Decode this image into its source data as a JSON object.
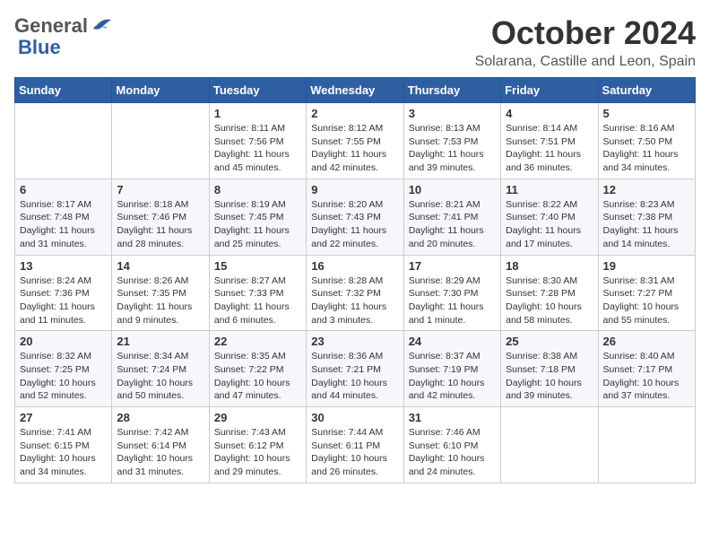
{
  "header": {
    "logo_general": "General",
    "logo_blue": "Blue",
    "month": "October 2024",
    "location": "Solarana, Castille and Leon, Spain"
  },
  "weekdays": [
    "Sunday",
    "Monday",
    "Tuesday",
    "Wednesday",
    "Thursday",
    "Friday",
    "Saturday"
  ],
  "weeks": [
    [
      {
        "day": "",
        "sunrise": "",
        "sunset": "",
        "daylight": ""
      },
      {
        "day": "",
        "sunrise": "",
        "sunset": "",
        "daylight": ""
      },
      {
        "day": "1",
        "sunrise": "Sunrise: 8:11 AM",
        "sunset": "Sunset: 7:56 PM",
        "daylight": "Daylight: 11 hours and 45 minutes."
      },
      {
        "day": "2",
        "sunrise": "Sunrise: 8:12 AM",
        "sunset": "Sunset: 7:55 PM",
        "daylight": "Daylight: 11 hours and 42 minutes."
      },
      {
        "day": "3",
        "sunrise": "Sunrise: 8:13 AM",
        "sunset": "Sunset: 7:53 PM",
        "daylight": "Daylight: 11 hours and 39 minutes."
      },
      {
        "day": "4",
        "sunrise": "Sunrise: 8:14 AM",
        "sunset": "Sunset: 7:51 PM",
        "daylight": "Daylight: 11 hours and 36 minutes."
      },
      {
        "day": "5",
        "sunrise": "Sunrise: 8:16 AM",
        "sunset": "Sunset: 7:50 PM",
        "daylight": "Daylight: 11 hours and 34 minutes."
      }
    ],
    [
      {
        "day": "6",
        "sunrise": "Sunrise: 8:17 AM",
        "sunset": "Sunset: 7:48 PM",
        "daylight": "Daylight: 11 hours and 31 minutes."
      },
      {
        "day": "7",
        "sunrise": "Sunrise: 8:18 AM",
        "sunset": "Sunset: 7:46 PM",
        "daylight": "Daylight: 11 hours and 28 minutes."
      },
      {
        "day": "8",
        "sunrise": "Sunrise: 8:19 AM",
        "sunset": "Sunset: 7:45 PM",
        "daylight": "Daylight: 11 hours and 25 minutes."
      },
      {
        "day": "9",
        "sunrise": "Sunrise: 8:20 AM",
        "sunset": "Sunset: 7:43 PM",
        "daylight": "Daylight: 11 hours and 22 minutes."
      },
      {
        "day": "10",
        "sunrise": "Sunrise: 8:21 AM",
        "sunset": "Sunset: 7:41 PM",
        "daylight": "Daylight: 11 hours and 20 minutes."
      },
      {
        "day": "11",
        "sunrise": "Sunrise: 8:22 AM",
        "sunset": "Sunset: 7:40 PM",
        "daylight": "Daylight: 11 hours and 17 minutes."
      },
      {
        "day": "12",
        "sunrise": "Sunrise: 8:23 AM",
        "sunset": "Sunset: 7:38 PM",
        "daylight": "Daylight: 11 hours and 14 minutes."
      }
    ],
    [
      {
        "day": "13",
        "sunrise": "Sunrise: 8:24 AM",
        "sunset": "Sunset: 7:36 PM",
        "daylight": "Daylight: 11 hours and 11 minutes."
      },
      {
        "day": "14",
        "sunrise": "Sunrise: 8:26 AM",
        "sunset": "Sunset: 7:35 PM",
        "daylight": "Daylight: 11 hours and 9 minutes."
      },
      {
        "day": "15",
        "sunrise": "Sunrise: 8:27 AM",
        "sunset": "Sunset: 7:33 PM",
        "daylight": "Daylight: 11 hours and 6 minutes."
      },
      {
        "day": "16",
        "sunrise": "Sunrise: 8:28 AM",
        "sunset": "Sunset: 7:32 PM",
        "daylight": "Daylight: 11 hours and 3 minutes."
      },
      {
        "day": "17",
        "sunrise": "Sunrise: 8:29 AM",
        "sunset": "Sunset: 7:30 PM",
        "daylight": "Daylight: 11 hours and 1 minute."
      },
      {
        "day": "18",
        "sunrise": "Sunrise: 8:30 AM",
        "sunset": "Sunset: 7:28 PM",
        "daylight": "Daylight: 10 hours and 58 minutes."
      },
      {
        "day": "19",
        "sunrise": "Sunrise: 8:31 AM",
        "sunset": "Sunset: 7:27 PM",
        "daylight": "Daylight: 10 hours and 55 minutes."
      }
    ],
    [
      {
        "day": "20",
        "sunrise": "Sunrise: 8:32 AM",
        "sunset": "Sunset: 7:25 PM",
        "daylight": "Daylight: 10 hours and 52 minutes."
      },
      {
        "day": "21",
        "sunrise": "Sunrise: 8:34 AM",
        "sunset": "Sunset: 7:24 PM",
        "daylight": "Daylight: 10 hours and 50 minutes."
      },
      {
        "day": "22",
        "sunrise": "Sunrise: 8:35 AM",
        "sunset": "Sunset: 7:22 PM",
        "daylight": "Daylight: 10 hours and 47 minutes."
      },
      {
        "day": "23",
        "sunrise": "Sunrise: 8:36 AM",
        "sunset": "Sunset: 7:21 PM",
        "daylight": "Daylight: 10 hours and 44 minutes."
      },
      {
        "day": "24",
        "sunrise": "Sunrise: 8:37 AM",
        "sunset": "Sunset: 7:19 PM",
        "daylight": "Daylight: 10 hours and 42 minutes."
      },
      {
        "day": "25",
        "sunrise": "Sunrise: 8:38 AM",
        "sunset": "Sunset: 7:18 PM",
        "daylight": "Daylight: 10 hours and 39 minutes."
      },
      {
        "day": "26",
        "sunrise": "Sunrise: 8:40 AM",
        "sunset": "Sunset: 7:17 PM",
        "daylight": "Daylight: 10 hours and 37 minutes."
      }
    ],
    [
      {
        "day": "27",
        "sunrise": "Sunrise: 7:41 AM",
        "sunset": "Sunset: 6:15 PM",
        "daylight": "Daylight: 10 hours and 34 minutes."
      },
      {
        "day": "28",
        "sunrise": "Sunrise: 7:42 AM",
        "sunset": "Sunset: 6:14 PM",
        "daylight": "Daylight: 10 hours and 31 minutes."
      },
      {
        "day": "29",
        "sunrise": "Sunrise: 7:43 AM",
        "sunset": "Sunset: 6:12 PM",
        "daylight": "Daylight: 10 hours and 29 minutes."
      },
      {
        "day": "30",
        "sunrise": "Sunrise: 7:44 AM",
        "sunset": "Sunset: 6:11 PM",
        "daylight": "Daylight: 10 hours and 26 minutes."
      },
      {
        "day": "31",
        "sunrise": "Sunrise: 7:46 AM",
        "sunset": "Sunset: 6:10 PM",
        "daylight": "Daylight: 10 hours and 24 minutes."
      },
      {
        "day": "",
        "sunrise": "",
        "sunset": "",
        "daylight": ""
      },
      {
        "day": "",
        "sunrise": "",
        "sunset": "",
        "daylight": ""
      }
    ]
  ]
}
